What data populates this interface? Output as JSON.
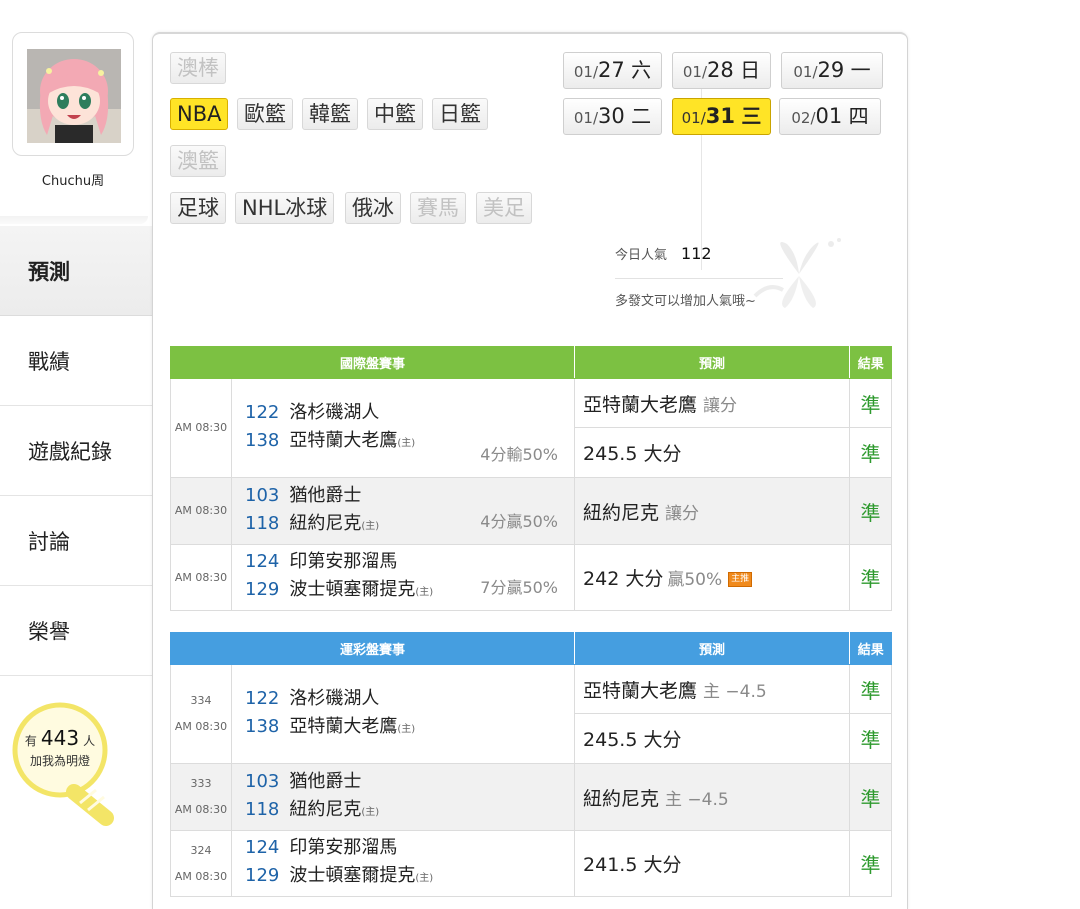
{
  "sidebar": {
    "username": "Chuchu周",
    "nav": [
      "預測",
      "戰績",
      "遊戲紀錄",
      "討論",
      "榮譽"
    ],
    "fans_prefix": "有",
    "fans_count": "443",
    "fans_suffix": "人",
    "fans_label": "加我為明燈"
  },
  "sports": {
    "aobang": "澳棒",
    "nba": "NBA",
    "eurobb": "歐籃",
    "korbb": "韓籃",
    "chnbb": "中籃",
    "jpnbb": "日籃",
    "ausbb": "澳籃",
    "soccer": "足球",
    "nhl": "NHL冰球",
    "rushockey": "俄冰",
    "horse": "賽馬",
    "usfootball": "美足"
  },
  "dates": [
    {
      "md": "01/",
      "d": "27",
      "w": "六"
    },
    {
      "md": "01/",
      "d": "28",
      "w": "日"
    },
    {
      "md": "01/",
      "d": "29",
      "w": "一"
    },
    {
      "md": "01/",
      "d": "30",
      "w": "二"
    },
    {
      "md": "01/",
      "d": "31",
      "w": "三"
    },
    {
      "md": "02/",
      "d": "01",
      "w": "四"
    }
  ],
  "popularity": {
    "label": "今日人氣",
    "count": "112",
    "note": "多發文可以增加人氣哦~"
  },
  "intl": {
    "headers": {
      "event": "國際盤賽事",
      "pred": "預測",
      "result": "結果"
    },
    "games": [
      {
        "time": "AM 08:30",
        "away_num": "122",
        "away": "洛杉磯湖人",
        "home_num": "138",
        "home": "亞特蘭大老鷹",
        "home_tag": "(主)",
        "odds": "4分輸50%",
        "pred1": "亞特蘭大老鷹",
        "pred1_sub": "讓分",
        "res1": "準",
        "pred2": "245.5 大分",
        "res2": "準"
      },
      {
        "time": "AM 08:30",
        "away_num": "103",
        "away": "猶他爵士",
        "home_num": "118",
        "home": "紐約尼克",
        "home_tag": "(主)",
        "odds": "4分贏50%",
        "pred1": "紐約尼克",
        "pred1_sub": "讓分",
        "res1": "準"
      },
      {
        "time": "AM 08:30",
        "away_num": "124",
        "away": "印第安那溜馬",
        "home_num": "129",
        "home": "波士頓塞爾提克",
        "home_tag": "(主)",
        "odds": "7分贏50%",
        "pred1": "242 大分",
        "pred1_sub": "贏50%",
        "badge": "主推",
        "res1": "準"
      }
    ]
  },
  "sportslottery": {
    "headers": {
      "event": "運彩盤賽事",
      "pred": "預測",
      "result": "結果"
    },
    "games": [
      {
        "code": "334",
        "time": "AM 08:30",
        "away_num": "122",
        "away": "洛杉磯湖人",
        "home_num": "138",
        "home": "亞特蘭大老鷹",
        "home_tag": "(主)",
        "pred1": "亞特蘭大老鷹",
        "pred1_sub": "主 −4.5",
        "res1": "準",
        "pred2": "245.5 大分",
        "res2": "準"
      },
      {
        "code": "333",
        "time": "AM 08:30",
        "away_num": "103",
        "away": "猶他爵士",
        "home_num": "118",
        "home": "紐約尼克",
        "home_tag": "(主)",
        "pred1": "紐約尼克",
        "pred1_sub": "主 −4.5",
        "res1": "準"
      },
      {
        "code": "324",
        "time": "AM 08:30",
        "away_num": "124",
        "away": "印第安那溜馬",
        "home_num": "129",
        "home": "波士頓塞爾提克",
        "home_tag": "(主)",
        "pred1": "241.5 大分",
        "res1": "準"
      }
    ]
  },
  "colors": {
    "green_header": "#7cc142",
    "blue_header": "#459ee0",
    "highlight": "#ffe426",
    "correct": "#2e9a2e",
    "team_num": "#1e63a8"
  }
}
